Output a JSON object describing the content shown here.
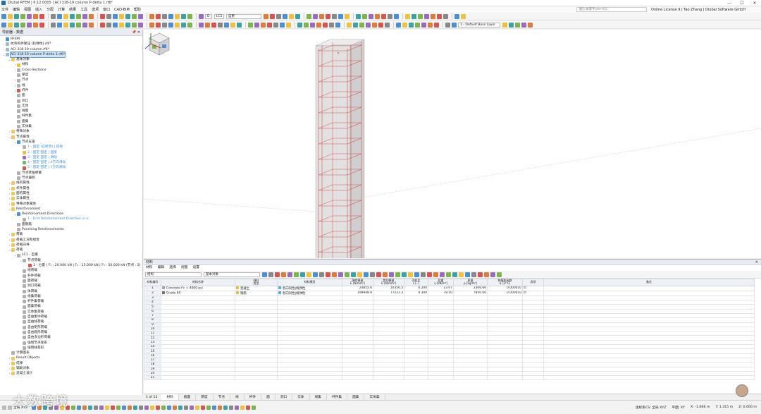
{
  "title": "Dlubal RFEM | 6.12.0005 | ACI 318-19 column P-delta 1.rf6*",
  "window_buttons": [
    "—",
    "☐",
    "✕"
  ],
  "menu": [
    "文件",
    "编辑",
    "视图",
    "插入",
    "分配",
    "计算",
    "结果",
    "工具",
    "选项",
    "窗口",
    "CAD-BIM",
    "帮助"
  ],
  "search_placeholder": "输入关键字(Alt+Q)",
  "license": "Online License 9 | Tao Zhang | Dlubal Software GmbH",
  "toolbar": {
    "loadcase_code": "D",
    "loadcase": "LC1",
    "loadcase_name": "自重",
    "layer": "1 - Default Base Layer"
  },
  "navigator": {
    "title": "导航器 - 数据",
    "pin": "📌 ✕",
    "items": [
      {
        "label": "RFEM",
        "level": 0,
        "icon": "ic-blue",
        "exp": ""
      },
      {
        "label": "抗弯构件受压 (轮弹性).rf6*",
        "level": 0,
        "icon": "ic-doc",
        "exp": "›"
      },
      {
        "label": "ACI 318-19 column.rf6*",
        "level": 0,
        "icon": "ic-doc",
        "exp": "›"
      },
      {
        "label": "ACI 318-19 column P-delta 1.rf6*",
        "level": 0,
        "icon": "ic-doc",
        "exp": "⌄",
        "selected": true
      },
      {
        "label": "基本对象",
        "level": 1,
        "icon": "ic-folder",
        "exp": "⌄"
      },
      {
        "label": "材料",
        "level": 2,
        "icon": "ic-yellow",
        "exp": "›"
      },
      {
        "label": "Cross-Sections",
        "level": 2,
        "icon": "ic-grey",
        "exp": "›"
      },
      {
        "label": "厚度",
        "level": 2,
        "icon": "ic-grey",
        "exp": ""
      },
      {
        "label": "节点",
        "level": 2,
        "icon": "ic-grey",
        "exp": "›"
      },
      {
        "label": "线",
        "level": 2,
        "icon": "ic-grey",
        "exp": "›"
      },
      {
        "label": "杆件",
        "level": 2,
        "icon": "ic-red",
        "exp": "›"
      },
      {
        "label": "面",
        "level": 2,
        "icon": "ic-grey",
        "exp": ""
      },
      {
        "label": "洞口",
        "level": 2,
        "icon": "ic-grey",
        "exp": ""
      },
      {
        "label": "实体",
        "level": 2,
        "icon": "ic-grey",
        "exp": ""
      },
      {
        "label": "线集",
        "level": 2,
        "icon": "ic-grey",
        "exp": ""
      },
      {
        "label": "杆件集",
        "level": 2,
        "icon": "ic-grey",
        "exp": ""
      },
      {
        "label": "面集",
        "level": 2,
        "icon": "ic-grey",
        "exp": ""
      },
      {
        "label": "实体集",
        "level": 2,
        "icon": "ic-grey",
        "exp": ""
      },
      {
        "label": "特殊对象",
        "level": 1,
        "icon": "ic-folder",
        "exp": "›"
      },
      {
        "label": "节点属性",
        "level": 1,
        "icon": "ic-folder",
        "exp": "⌄"
      },
      {
        "label": "节点支座",
        "level": 2,
        "icon": "ic-blue",
        "exp": "⌄"
      },
      {
        "label": "1 - 固定 (已修改) | 铰接",
        "level": 3,
        "icon": "ic-grey",
        "exp": "",
        "blue": true
      },
      {
        "label": "2 - 固定 固定 | 固接",
        "level": 3,
        "icon": "ic-yellow",
        "exp": "",
        "blue": true
      },
      {
        "label": "3 - 固定 固定 | 滑动",
        "level": 3,
        "icon": "ic-purple",
        "exp": "",
        "blue": true
      },
      {
        "label": "4 - 固定 固定 | X方向滑动",
        "level": 3,
        "icon": "ic-green",
        "exp": "",
        "blue": true
      },
      {
        "label": "5 - 固定 固定 | Y方向滑动",
        "level": 3,
        "icon": "ic-red",
        "exp": "",
        "blue": true
      },
      {
        "label": "节点转角弹簧",
        "level": 2,
        "icon": "ic-grey",
        "exp": ""
      },
      {
        "label": "节点偏移",
        "level": 2,
        "icon": "ic-grey",
        "exp": ""
      },
      {
        "label": "线的属性",
        "level": 1,
        "icon": "ic-folder",
        "exp": "›"
      },
      {
        "label": "杆件属性",
        "level": 1,
        "icon": "ic-folder",
        "exp": "›"
      },
      {
        "label": "面的属性",
        "level": 1,
        "icon": "ic-folder",
        "exp": "›"
      },
      {
        "label": "实体属性",
        "level": 1,
        "icon": "ic-folder",
        "exp": "›"
      },
      {
        "label": "特殊对象属性",
        "level": 1,
        "icon": "ic-folder",
        "exp": "›"
      },
      {
        "label": "Reinforcement",
        "level": 1,
        "icon": "ic-folder",
        "exp": "⌄"
      },
      {
        "label": "Reinforcement Directions",
        "level": 2,
        "icon": "ic-blue",
        "exp": "⌄"
      },
      {
        "label": "1 - First Reinforcement Direction in x",
        "level": 3,
        "icon": "ic-grey",
        "exp": "",
        "blue": true
      },
      {
        "label": "面钢筋",
        "level": 2,
        "icon": "ic-grey",
        "exp": ""
      },
      {
        "label": "Punching Reinforcements",
        "level": 2,
        "icon": "ic-grey",
        "exp": ""
      },
      {
        "label": "荷载",
        "level": 1,
        "icon": "ic-folder",
        "exp": "›"
      },
      {
        "label": "荷载工况和组合",
        "level": 1,
        "icon": "ic-folder",
        "exp": "›"
      },
      {
        "label": "荷载向导",
        "level": 1,
        "icon": "ic-folder",
        "exp": "›"
      },
      {
        "label": "荷载",
        "level": 1,
        "icon": "ic-folder",
        "exp": "⌄"
      },
      {
        "label": "LC1 - 自重",
        "level": 2,
        "icon": "ic-grey",
        "exp": "⌄"
      },
      {
        "label": "节点荷载",
        "level": 3,
        "icon": "ic-grey",
        "exp": "⌄"
      },
      {
        "label": "1 - 分量 | F₁ : 20.000 kN | F₂ : 15.000 kN | F₃ : 50.000 kN (节点 : 2)",
        "level": 4,
        "icon": "ic-red",
        "exp": ""
      },
      {
        "label": "线荷载",
        "level": 3,
        "icon": "ic-grey",
        "exp": ""
      },
      {
        "label": "杆件荷载",
        "level": 3,
        "icon": "ic-grey",
        "exp": ""
      },
      {
        "label": "面荷载",
        "level": 3,
        "icon": "ic-grey",
        "exp": ""
      },
      {
        "label": "洞口荷载",
        "level": 3,
        "icon": "ic-grey",
        "exp": ""
      },
      {
        "label": "体荷载",
        "level": 3,
        "icon": "ic-grey",
        "exp": ""
      },
      {
        "label": "线集荷载",
        "level": 3,
        "icon": "ic-grey",
        "exp": ""
      },
      {
        "label": "杆件集荷载",
        "level": 3,
        "icon": "ic-grey",
        "exp": ""
      },
      {
        "label": "面集荷载",
        "level": 3,
        "icon": "ic-grey",
        "exp": ""
      },
      {
        "label": "实体集荷载",
        "level": 3,
        "icon": "ic-grey",
        "exp": ""
      },
      {
        "label": "自由集中荷载",
        "level": 3,
        "icon": "ic-grey",
        "exp": ""
      },
      {
        "label": "自由线荷载",
        "level": 3,
        "icon": "ic-grey",
        "exp": ""
      },
      {
        "label": "自由矩形荷载",
        "level": 3,
        "icon": "ic-grey",
        "exp": ""
      },
      {
        "label": "自由圆形荷载",
        "level": 3,
        "icon": "ic-grey",
        "exp": ""
      },
      {
        "label": "自由多边形荷载",
        "level": 3,
        "icon": "ic-grey",
        "exp": ""
      },
      {
        "label": "强制节点变形",
        "level": 3,
        "icon": "ic-grey",
        "exp": ""
      },
      {
        "label": "强制线变形",
        "level": 3,
        "icon": "ic-grey",
        "exp": ""
      },
      {
        "label": "计算图表",
        "level": 1,
        "icon": "ic-grey",
        "exp": ""
      },
      {
        "label": "Result Objects",
        "level": 1,
        "icon": "ic-folder",
        "exp": "›"
      },
      {
        "label": "成果",
        "level": 1,
        "icon": "ic-folder",
        "exp": "›"
      },
      {
        "label": "辅助对象",
        "level": 1,
        "icon": "ic-folder",
        "exp": "›"
      },
      {
        "label": "混凝土设计",
        "level": 1,
        "icon": "ic-folder",
        "exp": "›"
      }
    ]
  },
  "table_panel": {
    "title": "材料",
    "menu": [
      "材料",
      "编辑",
      "选择",
      "视图",
      "设置"
    ],
    "category": "结构",
    "filter": "基本对象",
    "headers": [
      "材料编号",
      "材料名称",
      "材料\n类型",
      "材料模型",
      "弹性模量\nE [N/mm²]",
      "剪切模量\nG [N/mm²]",
      "泊松比\nν [--]",
      "容重\nγ [kN/m³]",
      "质量\nρ [kg/m³]",
      "热膨胀系数\nα [1/°C]",
      "选项",
      "备注"
    ],
    "rows": [
      {
        "no": "1",
        "name": "Concrete f'c = 4000 psi",
        "name_color": "#9aa7b3",
        "type": "混凝土",
        "type_color": "#e3c23a",
        "model": "各向同性|线弹性",
        "model_color": "#55b3d6",
        "E": "24855.6",
        "G": "10356.5",
        "nu": "0.200",
        "gamma": "23.07",
        "rho": "2306.66",
        "alpha": "0.000010",
        "opt": "⊡",
        "note": ""
      },
      {
        "no": "2",
        "name": "Grade 60",
        "name_color": "#7d6f60",
        "type": "钢筋",
        "type_color": "#e3c23a",
        "model": "各向同性|线弹性",
        "model_color": "#55b3d6",
        "E": "199948.0",
        "G": "77221.3",
        "nu": "0.300",
        "gamma": "78.50",
        "rho": "7850.00",
        "alpha": "0.000010",
        "opt": "⊡",
        "note": ""
      }
    ],
    "empty_rows": [
      "3",
      "4",
      "5",
      "6",
      "7",
      "8",
      "9",
      "10",
      "11",
      "12",
      "13",
      "14",
      "15",
      "16",
      "17",
      "18",
      "19",
      "20",
      "21"
    ],
    "pager": "1 of 13",
    "tabs": [
      "材料",
      "截面",
      "厚度",
      "节点",
      "线",
      "杆件",
      "面",
      "洞口",
      "实体",
      "线集",
      "杆件集",
      "面集",
      "实体集"
    ]
  },
  "status": {
    "cs": "全局 XYZ",
    "system": "坐标系CS: 全局 XYZ",
    "plane": "平面: XY",
    "x": "X: -1.668 m",
    "y": "Y: 1.315 m",
    "z": "Z: 0.000 m"
  },
  "watermark": "大数跨境",
  "colors": {
    "accent": "#1e6db3",
    "rebar": "#d9534f",
    "column": "#d8d8d8"
  }
}
